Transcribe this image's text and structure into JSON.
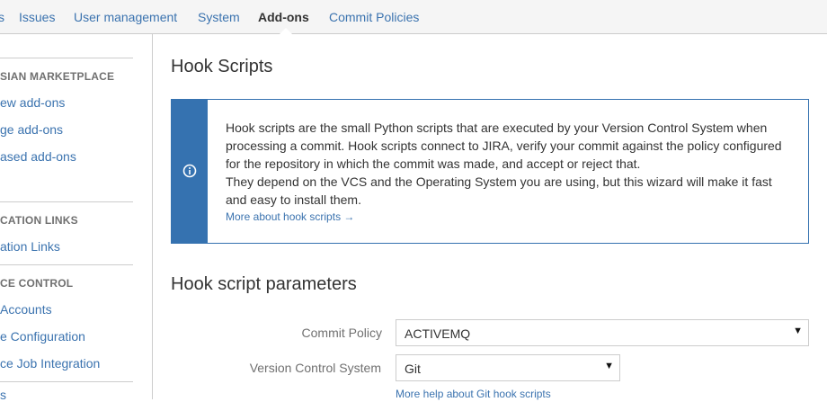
{
  "topnav": {
    "tabs": [
      {
        "label": "s"
      },
      {
        "label": "Issues"
      },
      {
        "label": "User management"
      },
      {
        "label": "System"
      },
      {
        "label": "Add-ons",
        "active": true
      },
      {
        "label": "Commit Policies"
      }
    ]
  },
  "sidebar": {
    "sections": [
      {
        "heading": "SIAN MARKETPLACE",
        "links": [
          "ew add-ons",
          "ge add-ons",
          "ased add-ons"
        ]
      },
      {
        "heading": "CATION LINKS",
        "links": [
          "ation Links"
        ]
      },
      {
        "heading": "CE CONTROL",
        "links": [
          "Accounts",
          "e Configuration",
          "ce Job Integration"
        ]
      }
    ],
    "trailing_fragment": "s"
  },
  "main": {
    "title": "Hook Scripts",
    "info": {
      "paragraph1": "Hook scripts are the small Python scripts that are executed by your Version Control System when processing a commit. Hook scripts connect to JIRA, verify your commit against the policy configured for the repository in which the commit was made, and accept or reject that.",
      "paragraph2": "They depend on the VCS and the Operating System you are using, but this wizard will make it fast and easy to install them.",
      "more_link": "More about hook scripts →"
    },
    "params_title": "Hook script parameters",
    "form": {
      "commit_policy_label": "Commit Policy",
      "commit_policy_value": "ACTIVEMQ",
      "vcs_label": "Version Control System",
      "vcs_value": "Git",
      "help_link": "More help about Git hook scripts"
    }
  },
  "icons": {
    "info": "info-circle-icon",
    "dropdown": "chevron-down-icon"
  },
  "colors": {
    "link": "#3b73af",
    "info_accent": "#3572b0",
    "nav_bg": "#f5f5f5",
    "border": "#cccccc"
  }
}
